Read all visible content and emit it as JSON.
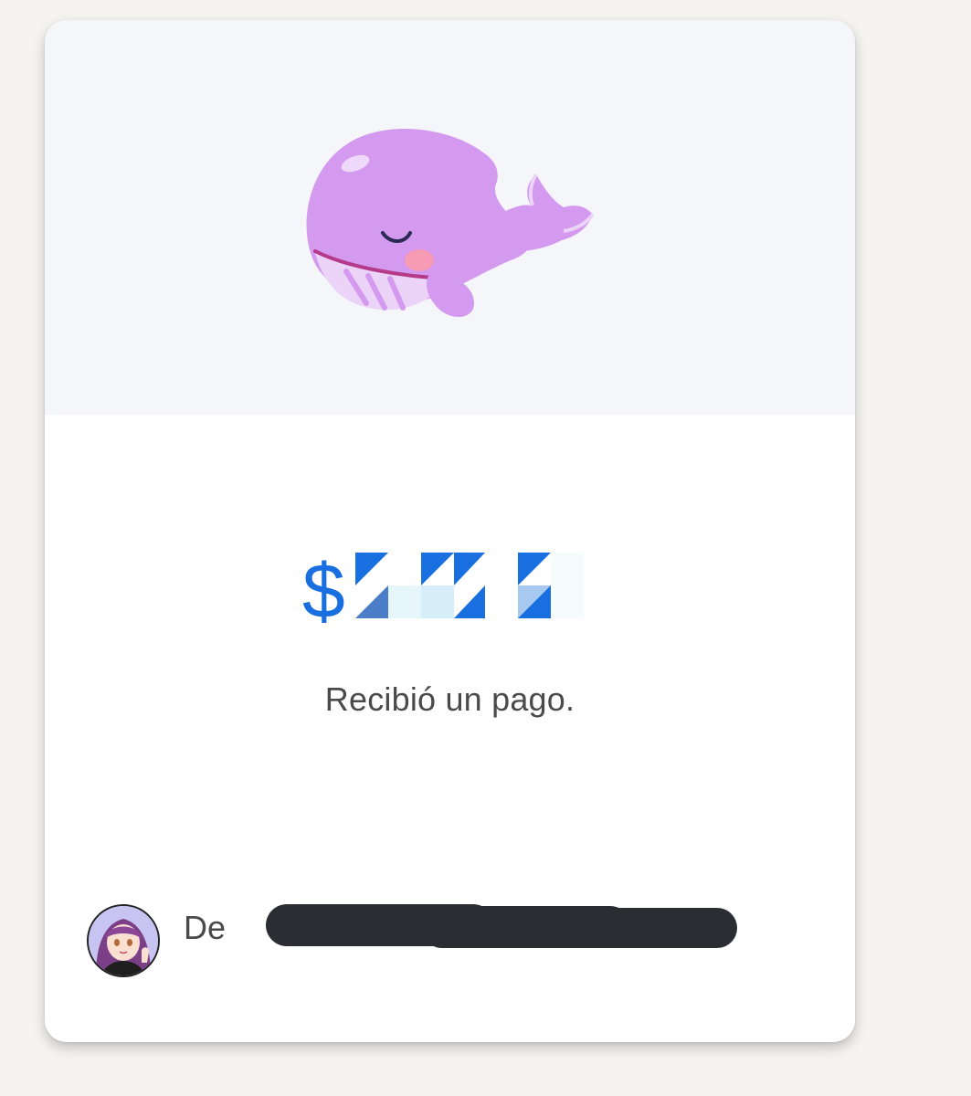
{
  "notification": {
    "illustration": "whale-illustration",
    "amount_currency": "$",
    "amount_value_redacted": true,
    "caption": "Recibió un pago.",
    "sender_prefix": "De",
    "sender_name_redacted": true
  },
  "colors": {
    "accent": "#1a6fe0",
    "whale_body": "#d49af0",
    "whale_belly": "#ecd4f8",
    "whale_stripe": "#b53a8a",
    "cheek": "#f79ab4",
    "hero_background": "#f5f6fa",
    "page_background": "#f5f4f0",
    "redaction": "#2a2e33"
  },
  "icons": {
    "avatar": "anime-girl-avatar"
  }
}
